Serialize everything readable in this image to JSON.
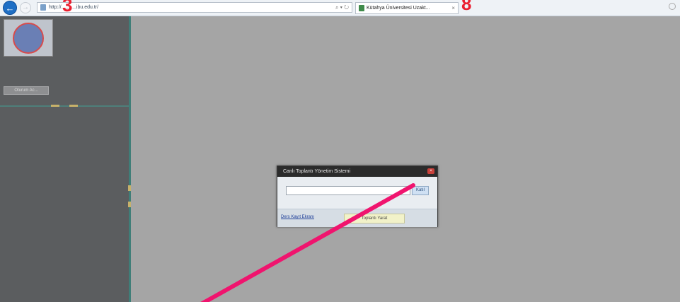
{
  "browser": {
    "back_icon": "arrow-left-icon",
    "forward_icon": "arrow-right-icon",
    "address_text": "http://...........ibu.edu.tr/",
    "address_tools": "⌕ ▾ ↻",
    "tab_title": "Kütahya Üniversitesi Uzakt...",
    "tab_close": "×"
  },
  "annotations": {
    "three": "3",
    "eight": "8",
    "arrow_color": "#f0146e",
    "mark_color": "#ea1f2f"
  },
  "sidebar": {
    "logo_icon": "university-seal-logo",
    "small_button_label": "Oturum Ac...",
    "marker_color": "#c7b16a"
  },
  "dialog": {
    "title": "Canlı Toplantı Yönetim Sistemi",
    "close_icon": "close-icon",
    "input_value": "",
    "action_button_label": "Katıl",
    "footer_link": "Ders Kayıt Ekranı",
    "footer_button_label": "Toplantı Yarat"
  },
  "colors": {
    "main_bg": "#a5a5a5",
    "sidebar_bg": "#5b5d5f",
    "sidebar_border": "#3f7e78"
  }
}
